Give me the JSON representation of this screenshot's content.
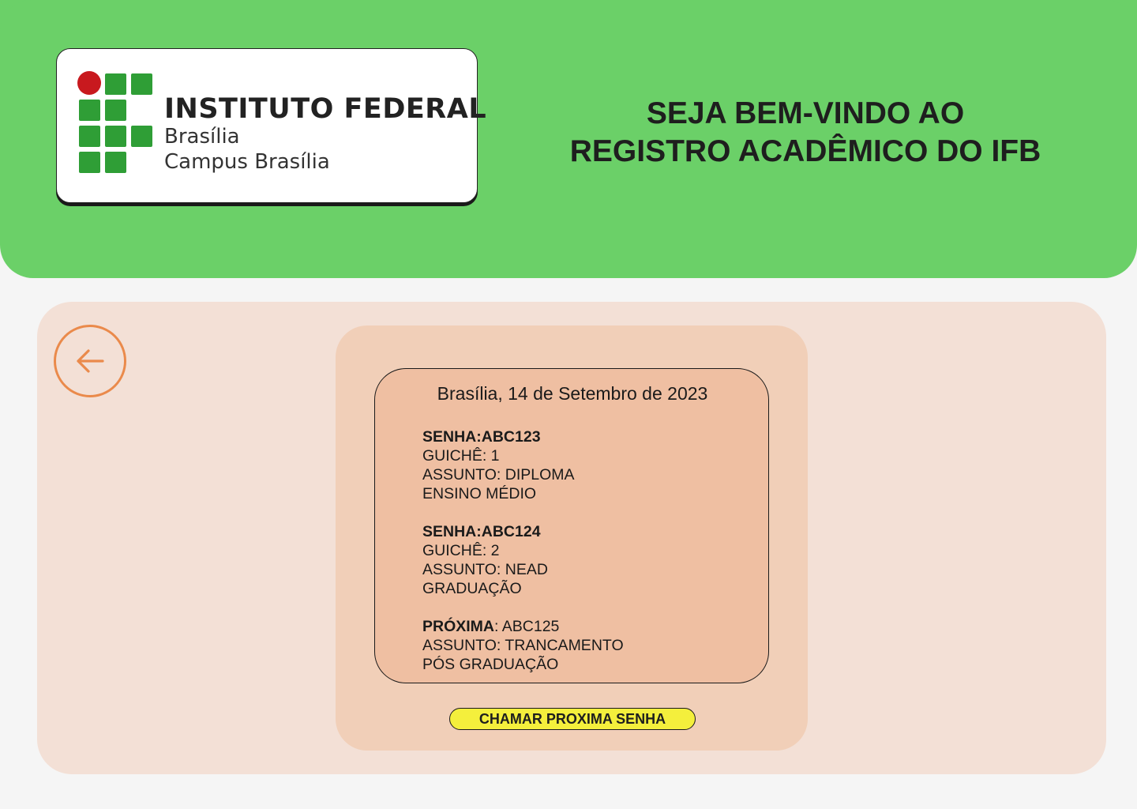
{
  "header": {
    "logo": {
      "title": "INSTITUTO FEDERAL",
      "subtitle_line1": "Brasília",
      "subtitle_line2": "Campus Brasília"
    },
    "welcome_line1": "SEJA BEM-VINDO AO",
    "welcome_line2": "REGISTRO ACADÊMICO DO IFB"
  },
  "nav": {
    "back_icon": "arrow-left-icon"
  },
  "ticket": {
    "date": "Brasília, 14 de Setembro de 2023",
    "entries": [
      {
        "label": "SENHA:ABC123",
        "guiche": "GUICHÊ: 1",
        "assunto": "ASSUNTO: DIPLOMA",
        "nivel": "ENSINO MÉDIO"
      },
      {
        "label": "SENHA:ABC124",
        "guiche": "GUICHÊ: 2",
        "assunto": "ASSUNTO: NEAD",
        "nivel": "GRADUAÇÃO"
      }
    ],
    "next": {
      "label": "PRÓXIMA",
      "code": ": ABC125",
      "assunto": "ASSUNTO: TRANCAMENTO",
      "nivel": "PÓS GRADUAÇÃO"
    }
  },
  "actions": {
    "call_next_label": "CHAMAR PROXIMA SENHA"
  },
  "colors": {
    "header_bg": "#6bd068",
    "panel_bg": "#f3e0d6",
    "card_bg": "#f1cfb8",
    "ticket_bg": "#efbfa2",
    "accent_orange": "#ea8a4b",
    "button_yellow": "#f4ef3c",
    "logo_green": "#2f9e36",
    "logo_red": "#c8191e"
  }
}
